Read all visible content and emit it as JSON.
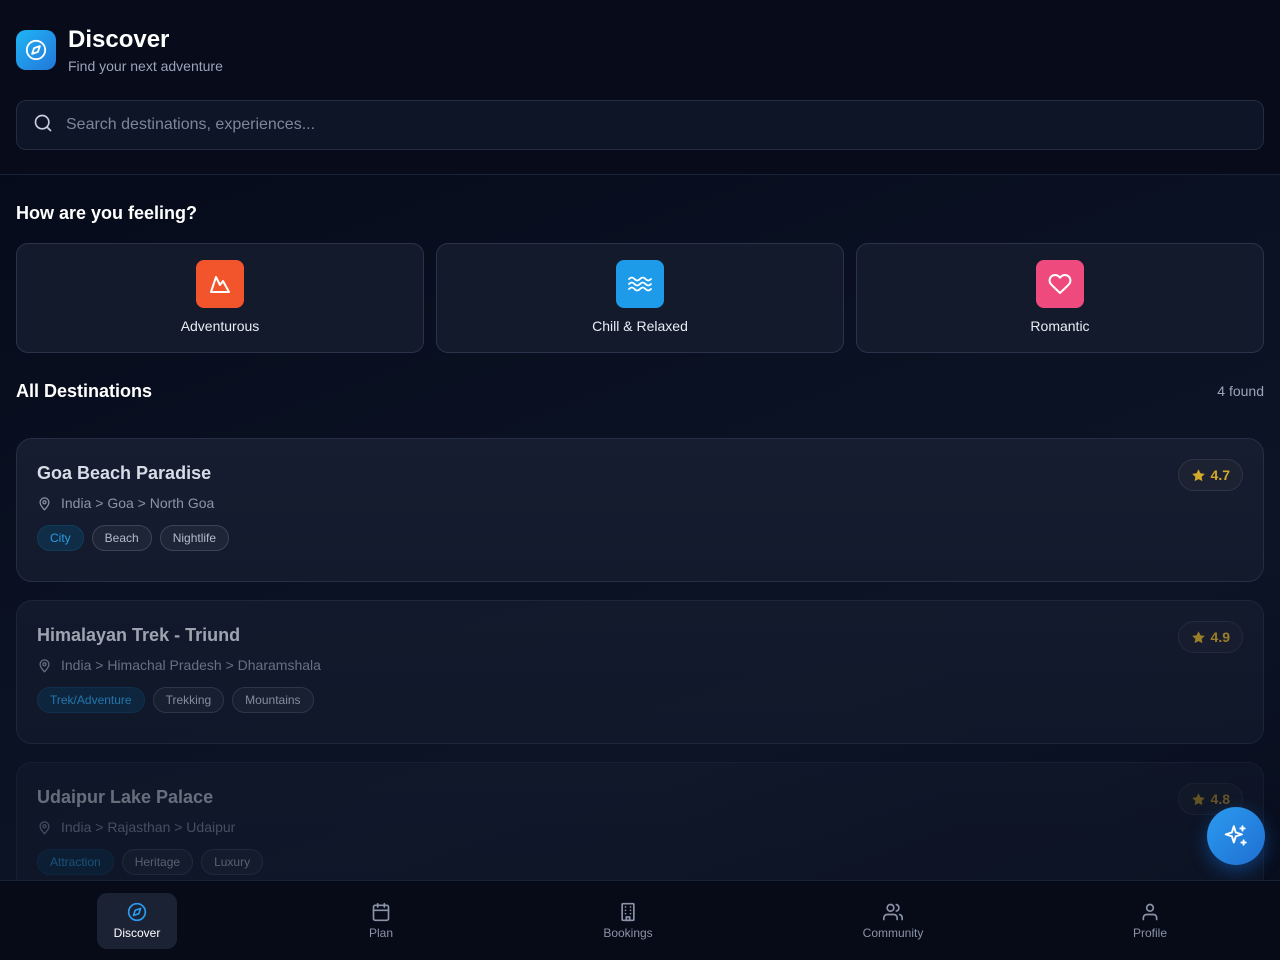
{
  "header": {
    "title": "Discover",
    "subtitle": "Find your next adventure",
    "brand_icon": "compass-icon"
  },
  "search": {
    "placeholder": "Search destinations, experiences...",
    "value": ""
  },
  "moods": {
    "title": "How are you feeling?",
    "items": [
      {
        "label": "Adventurous",
        "icon": "mountain-icon",
        "color": "#f2552c"
      },
      {
        "label": "Chill & Relaxed",
        "icon": "waves-icon",
        "color": "#1e9be8"
      },
      {
        "label": "Romantic",
        "icon": "heart-icon",
        "color": "#ee4a7e"
      }
    ]
  },
  "destinations": {
    "title": "All Destinations",
    "count": "4 found",
    "items": [
      {
        "name": "Goa Beach Paradise",
        "location": "India > Goa > North Goa",
        "rating": "4.7",
        "tags": [
          "City",
          "Beach",
          "Nightlife"
        ]
      },
      {
        "name": "Himalayan Trek - Triund",
        "location": "India > Himachal Pradesh > Dharamshala",
        "rating": "4.9",
        "tags": [
          "Trek/Adventure",
          "Trekking",
          "Mountains"
        ]
      },
      {
        "name": "Udaipur Lake Palace",
        "location": "India > Rajasthan > Udaipur",
        "rating": "4.8",
        "tags": [
          "Attraction",
          "Heritage",
          "Luxury"
        ]
      }
    ]
  },
  "fab": {
    "icon": "sparkles-icon"
  },
  "nav": {
    "items": [
      {
        "label": "Discover",
        "icon": "compass-icon",
        "active": true
      },
      {
        "label": "Plan",
        "icon": "calendar-icon"
      },
      {
        "label": "Bookings",
        "icon": "building-icon"
      },
      {
        "label": "Community",
        "icon": "users-icon"
      },
      {
        "label": "Profile",
        "icon": "user-icon"
      }
    ]
  },
  "colors": {
    "accent": "#2b9bf0",
    "rating": "#d4a82a",
    "background": "#070b1a"
  }
}
